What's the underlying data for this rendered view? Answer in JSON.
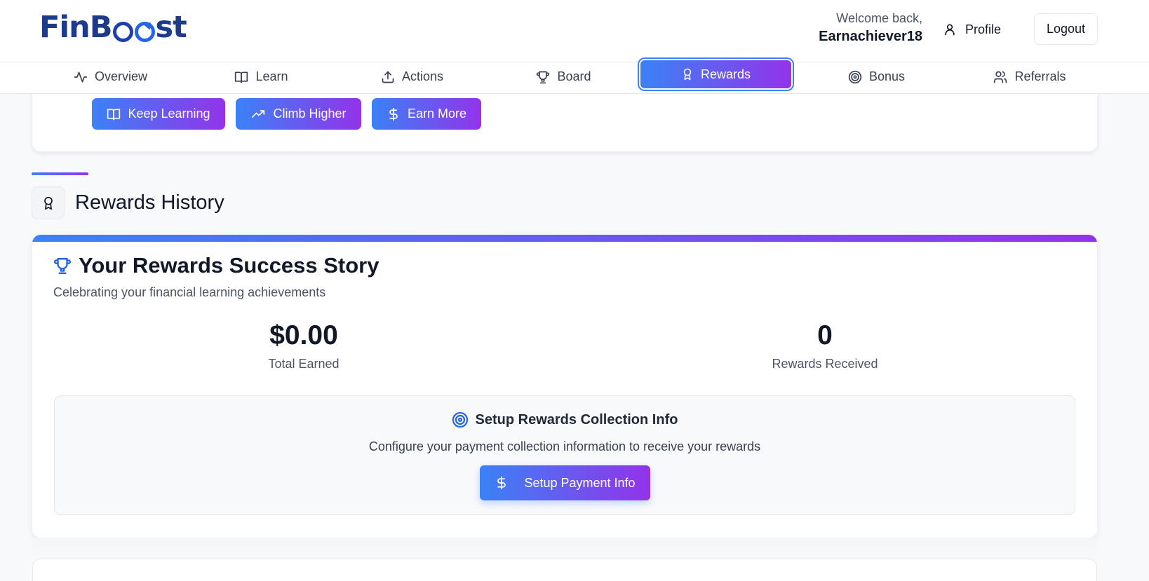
{
  "header": {
    "logo": "FinBoost",
    "welcome_line": "Welcome back,",
    "username": "Earnachiever18",
    "profile_label": "Profile",
    "logout_label": "Logout"
  },
  "tabs": [
    {
      "label": "Overview",
      "icon": "activity-icon"
    },
    {
      "label": "Learn",
      "icon": "book-icon"
    },
    {
      "label": "Actions",
      "icon": "upload-icon"
    },
    {
      "label": "Board",
      "icon": "trophy-icon"
    },
    {
      "label": "Rewards",
      "icon": "award-icon",
      "active": true
    },
    {
      "label": "Bonus",
      "icon": "target-icon"
    },
    {
      "label": "Referrals",
      "icon": "users-icon"
    }
  ],
  "quick_actions": [
    {
      "label": "Keep Learning",
      "icon": "book-icon"
    },
    {
      "label": "Climb Higher",
      "icon": "trending-up-icon"
    },
    {
      "label": "Earn More",
      "icon": "dollar-icon"
    }
  ],
  "section": {
    "title": "Rewards History",
    "icon": "award-icon"
  },
  "story": {
    "title": "Your Rewards Success Story",
    "subtitle": "Celebrating your financial learning achievements",
    "stats": [
      {
        "value": "$0.00",
        "label": "Total Earned"
      },
      {
        "value": "0",
        "label": "Rewards Received"
      }
    ]
  },
  "setup": {
    "title": "Setup Rewards Collection Info",
    "description": "Configure your payment collection information to receive your rewards",
    "button_label": "Setup Payment Info"
  },
  "colors": {
    "gradient_start": "#3b82f6",
    "gradient_end": "#9333ea",
    "logo": "#1e3a8a"
  }
}
